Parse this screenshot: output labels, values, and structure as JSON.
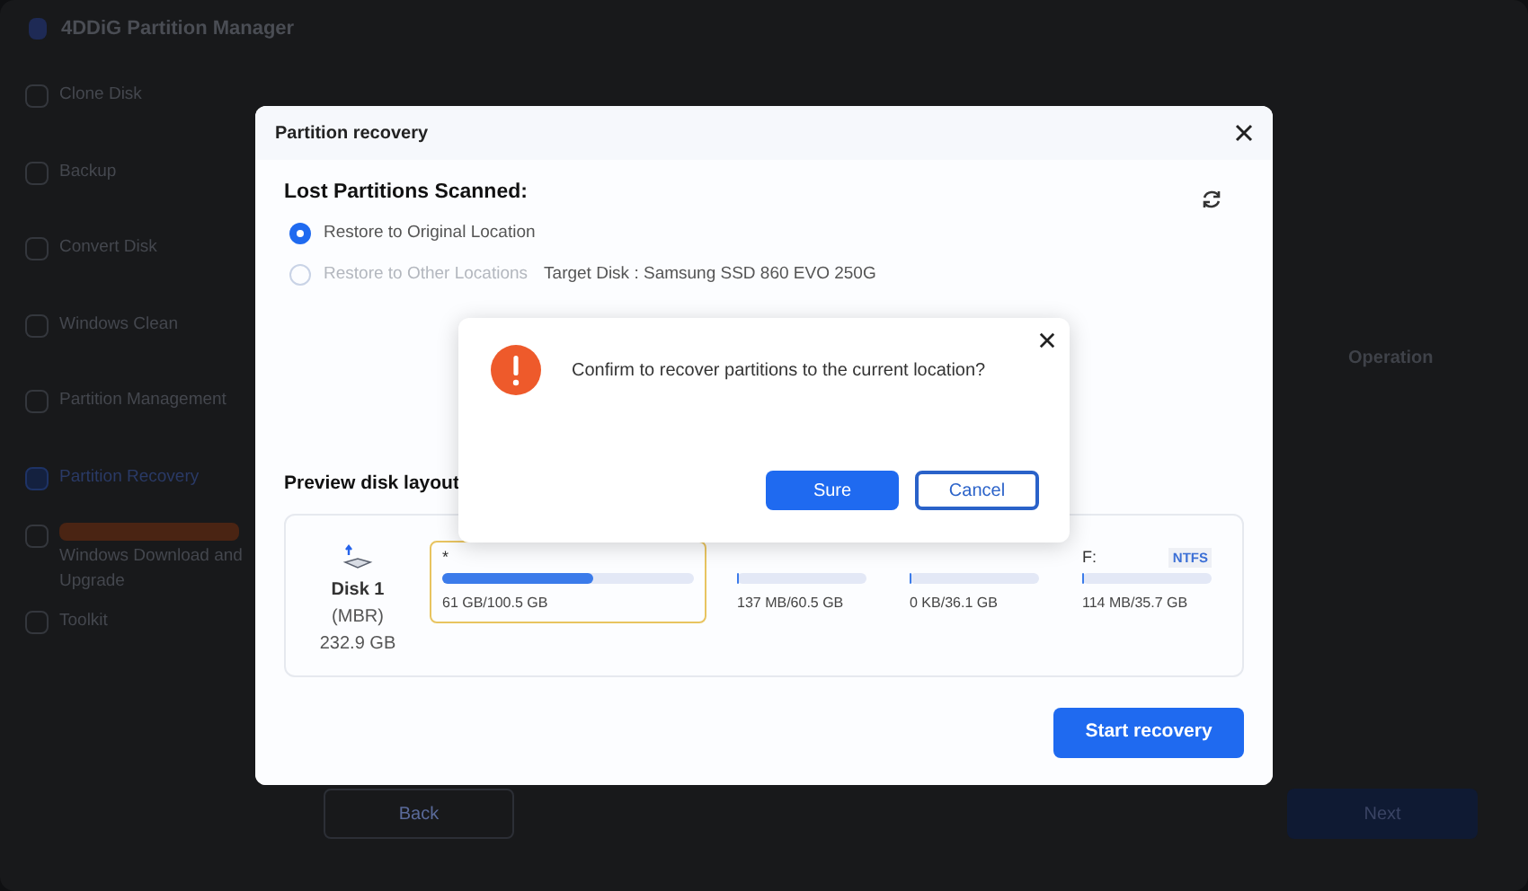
{
  "app": {
    "title": "4DDiG Partition Manager",
    "sidebar": {
      "items": [
        {
          "label": "Clone Disk",
          "selected": false
        },
        {
          "label": "Backup",
          "selected": false
        },
        {
          "label": "Convert Disk",
          "selected": false
        },
        {
          "label": "Windows Clean",
          "selected": false
        },
        {
          "label": "Partition Management",
          "selected": false
        },
        {
          "label": "Partition Recovery",
          "selected": true
        },
        {
          "label": "Windows Download and Upgrade",
          "selected": false,
          "badge": true
        },
        {
          "label": "Toolkit",
          "selected": false
        }
      ]
    },
    "table": {
      "columns": [
        "Operation"
      ]
    },
    "buttons": [
      "Back",
      "Next"
    ]
  },
  "dialog": {
    "title": "Partition recovery",
    "heading": "Lost Partitions Scanned:",
    "options": [
      {
        "label": "Restore to Original Location",
        "selected": true,
        "disabled": false
      },
      {
        "label": "Restore to Other Locations",
        "selected": false,
        "disabled": true,
        "detail": "Target Disk : Samsung SSD 860 EVO 250G"
      }
    ],
    "preview_label": "Preview disk layout",
    "disk": {
      "name": "Disk 1",
      "scheme": "(MBR)",
      "size": "232.9 GB"
    },
    "partitions": [
      {
        "label": "*",
        "selected": true,
        "level": 0.6,
        "usage": "61 GB/100.5 GB"
      },
      {
        "selected": false,
        "level": 0.02,
        "usage": "137 MB/60.5 GB"
      },
      {
        "selected": false,
        "level": 0.02,
        "usage": "0 KB/36.1 GB"
      },
      {
        "label": "F:",
        "fs": "NTFS",
        "selected": false,
        "level": 0.02,
        "usage": "114 MB/35.7 GB"
      }
    ],
    "primary_button": "Start recovery"
  },
  "confirm": {
    "message": "Confirm to recover partitions to the current location?",
    "buttons": [
      "Sure",
      "Cancel"
    ]
  }
}
